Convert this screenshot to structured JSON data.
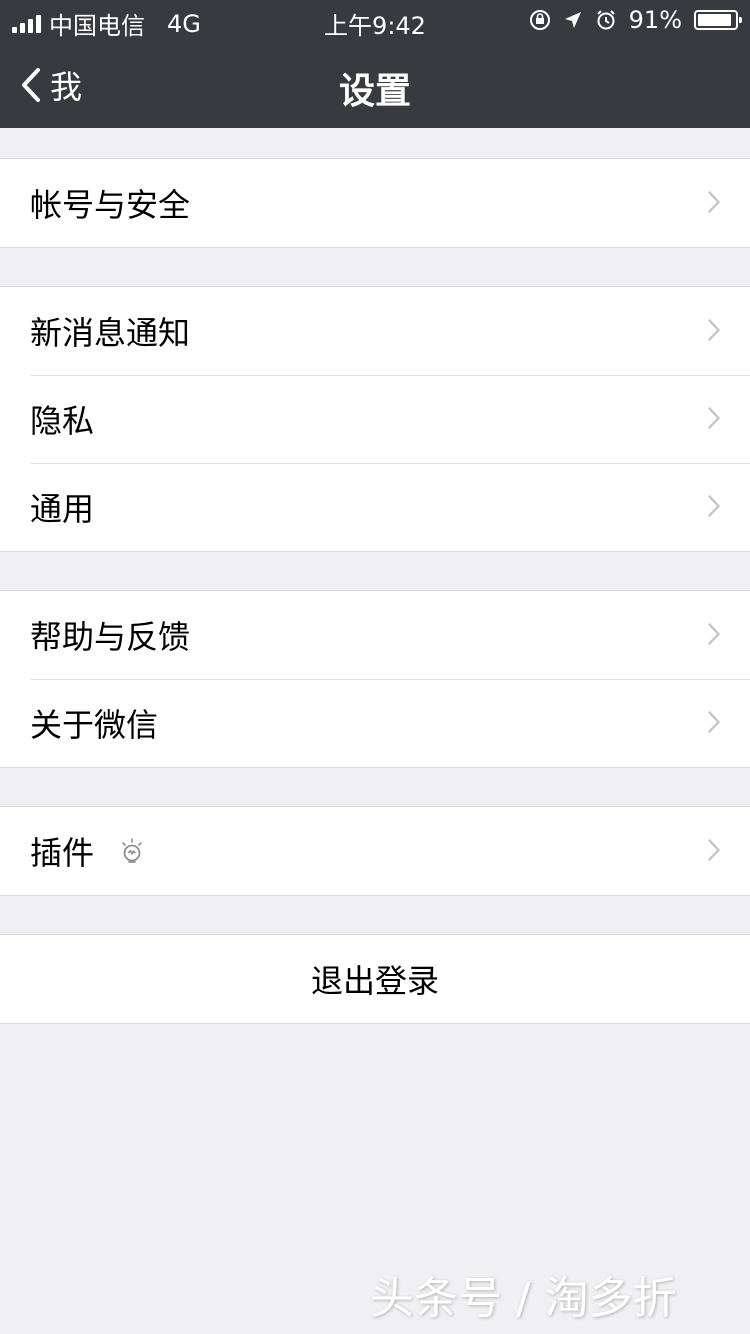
{
  "status_bar": {
    "carrier": "中国电信",
    "network": "4G",
    "time": "上午9:42",
    "battery_percent": "91%",
    "battery_level": 0.91,
    "icons": [
      "rotation-lock-icon",
      "location-arrow-icon",
      "alarm-icon",
      "battery-icon"
    ]
  },
  "nav": {
    "back_label": "我",
    "title": "设置"
  },
  "groups": {
    "account": {
      "items": [
        {
          "label": "帐号与安全"
        }
      ]
    },
    "main": {
      "items": [
        {
          "label": "新消息通知"
        },
        {
          "label": "隐私"
        },
        {
          "label": "通用"
        }
      ]
    },
    "help": {
      "items": [
        {
          "label": "帮助与反馈"
        },
        {
          "label": "关于微信"
        }
      ]
    },
    "plugins": {
      "items": [
        {
          "label": "插件",
          "icon": "lightbulb-icon"
        }
      ]
    }
  },
  "logout": {
    "label": "退出登录"
  },
  "watermark": {
    "text": "头条号 / 淘多折"
  },
  "colors": {
    "header_background": "#393a3f",
    "page_background": "#efeff4",
    "row_background": "#ffffff",
    "chevron": "#c7c7cc"
  }
}
